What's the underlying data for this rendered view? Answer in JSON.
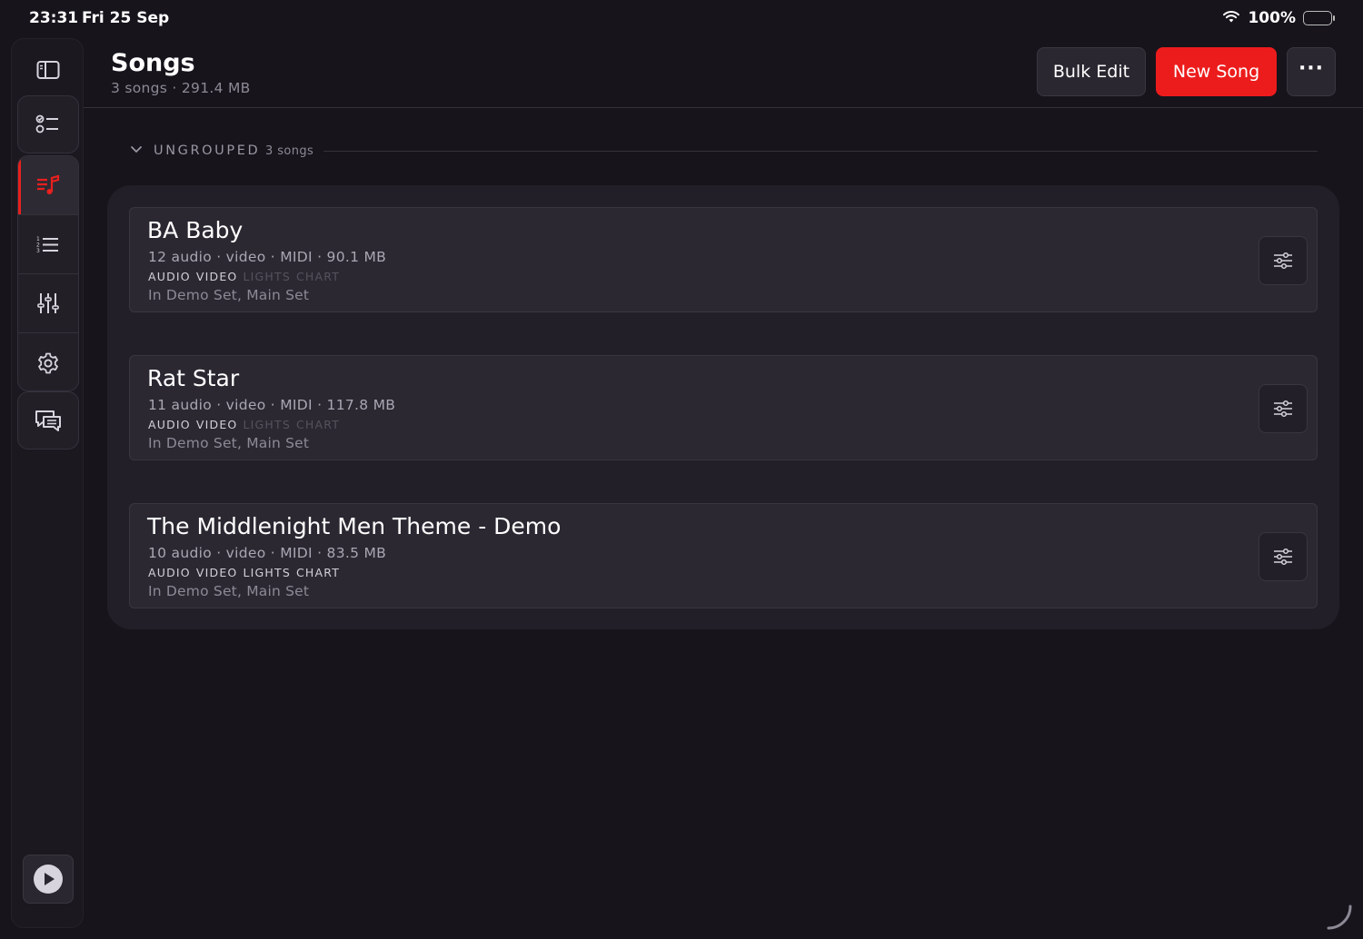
{
  "status_bar": {
    "time": "23:31",
    "date": "Fri 25 Sep",
    "battery": "100%"
  },
  "header": {
    "title": "Songs",
    "subtitle": "3 songs · 291.4 MB",
    "bulk_edit_label": "Bulk Edit",
    "new_song_label": "New Song",
    "more_label": "···"
  },
  "group": {
    "label": "UNGROUPED",
    "count": "3 songs"
  },
  "songs": [
    {
      "title": "BA Baby",
      "meta": "12 audio · video · MIDI · 90.1 MB",
      "tags": [
        {
          "label": "AUDIO",
          "active": true
        },
        {
          "label": "VIDEO",
          "active": true
        },
        {
          "label": "LIGHTS",
          "active": false
        },
        {
          "label": "CHART",
          "active": false
        }
      ],
      "sets": "In Demo Set, Main Set"
    },
    {
      "title": "Rat Star",
      "meta": "11 audio · video · MIDI · 117.8 MB",
      "tags": [
        {
          "label": "AUDIO",
          "active": true
        },
        {
          "label": "VIDEO",
          "active": true
        },
        {
          "label": "LIGHTS",
          "active": false
        },
        {
          "label": "CHART",
          "active": false
        }
      ],
      "sets": "In Demo Set, Main Set"
    },
    {
      "title": "The Middlenight Men Theme - Demo",
      "meta": "10 audio · video · MIDI · 83.5 MB",
      "tags": [
        {
          "label": "AUDIO",
          "active": true
        },
        {
          "label": "VIDEO",
          "active": true
        },
        {
          "label": "LIGHTS",
          "active": true
        },
        {
          "label": "CHART",
          "active": true
        }
      ],
      "sets": "In Demo Set, Main Set"
    }
  ],
  "sidebar": {
    "items": [
      {
        "icon": "sidebar-toggle-icon"
      },
      {
        "icon": "checklist-icon"
      },
      {
        "icon": "songs-icon",
        "active": true
      },
      {
        "icon": "numbered-list-icon"
      },
      {
        "icon": "mixer-sliders-icon"
      },
      {
        "icon": "gear-icon"
      },
      {
        "icon": "chat-bubbles-icon"
      },
      {
        "icon": "play-icon"
      }
    ]
  },
  "colors": {
    "accent": "#ed1c1c",
    "background": "#17141c",
    "panel": "#221f28",
    "card": "#2b2832"
  }
}
